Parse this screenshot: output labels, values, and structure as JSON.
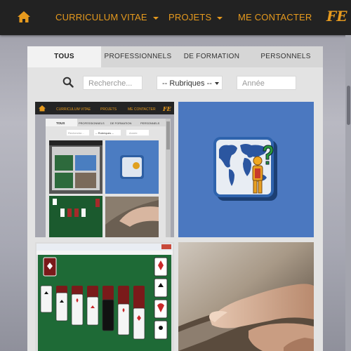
{
  "nav": {
    "items": [
      {
        "label": "CURRICULUM VITAE",
        "has_caret": true
      },
      {
        "label": "PROJETS",
        "has_caret": true
      },
      {
        "label": "ME CONTACTER",
        "has_caret": false
      }
    ],
    "brand": "FE",
    "icons": {
      "home": "home-icon"
    },
    "accent_color": "#e69a1e",
    "bar_color": "#222222"
  },
  "tabs": [
    {
      "label": "TOUS",
      "active": true
    },
    {
      "label": "PROFESSIONNELS",
      "active": false
    },
    {
      "label": "DE FORMATION",
      "active": false
    },
    {
      "label": "PERSONNELS",
      "active": false
    }
  ],
  "filters": {
    "search_placeholder": "Recherche...",
    "category_selected": "-- Rubriques --",
    "year_placeholder": "Année"
  },
  "gallery": [
    {
      "kind": "site-screenshot",
      "subject": "portfolio-page-thumbnail"
    },
    {
      "kind": "app-icon",
      "subject": "world-map-person-question"
    },
    {
      "kind": "game-screenshot",
      "subject": "solitaire"
    },
    {
      "kind": "photo",
      "subject": "finger-touching-tablet"
    }
  ],
  "mini_nav": {
    "items": [
      "CURRICULUM VITAE",
      "PROJETS",
      "ME CONTACTER"
    ],
    "brand": "FE",
    "tabs": [
      "TOUS",
      "PROFESSIONNELS",
      "DE FORMATION",
      "PERSONNELS"
    ],
    "search_placeholder": "Recherche...",
    "category_selected": "-- Rubriques --",
    "year_placeholder": "Année"
  }
}
